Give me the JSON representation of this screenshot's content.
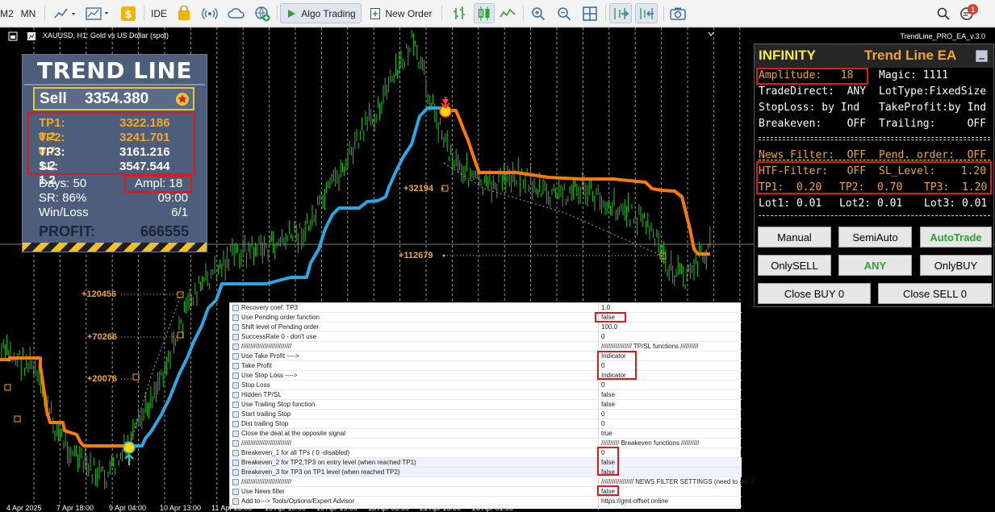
{
  "toolbar": {
    "tf_m2": "M2",
    "tf_mn": "MN",
    "ide": "IDE",
    "algo_trading": "Algo Trading",
    "new_order": "New Order",
    "notification_count": "1"
  },
  "chart": {
    "title": "XAUUSD, H1:  Gold vs US Dollar (spot)",
    "ea_name": "TrendLine_PRO_EA_v.3.0",
    "captions": [
      "+120456",
      "+70266",
      "+20076",
      "+32194",
      "+112679"
    ],
    "time_labels": [
      "4 Apr 2025",
      "7 Apr 18:00",
      "9 Apr 04:00",
      "10 Apr 13:00",
      "11 Apr 23:00",
      "15 Apr 10:00",
      "16 Apr 19:00",
      "18 Apr 05:00",
      "21 Apr 15:00",
      "23 Apr 01:00"
    ],
    "colors": {
      "up_trend": "#28a8e6",
      "down_trend": "#ff7a00",
      "candles": "#22c21b",
      "background": "#000000"
    }
  },
  "trend_panel": {
    "title": "TREND LINE",
    "signal": "Sell",
    "price": "3354.380",
    "tp_rows": [
      {
        "label": "TP1: 0.2",
        "value": "3322.186"
      },
      {
        "label": "TP2: 0.7",
        "value": "3241.701"
      },
      {
        "label": "TP3: 1.2",
        "value": "3161.216"
      },
      {
        "label": "SL: 1.2",
        "value": "3547.544"
      }
    ],
    "days": "Days: 50",
    "ampl": "Ampl: 18",
    "sr_label": "SR:  86%",
    "sr_value": "09:00",
    "winloss_label": "Win/Loss",
    "winloss_value": "6/1",
    "profit_label": "PROFIT:",
    "profit_value": "666555"
  },
  "ea_panel": {
    "title1": "INFINITY",
    "title2": "Trend Line EA",
    "amplitude": "Amplitude:   18",
    "magic": "Magic: 1111",
    "trade_direct": "TradeDirect:  ANY",
    "lot_type": "LotType:FixedSize",
    "stop_loss": "StopLoss: by Ind",
    "take_profit": "TakeProfit:by Ind",
    "breakeven": "Breakeven:    OFF",
    "trailing": "Trailing:     OFF",
    "news_filter": "News Filter:  OFF",
    "pend_order": "Pend. order:  OFF",
    "htf_filter": "HTF-Filter:   OFF",
    "sl_level": "SL_Level:    1.20",
    "tp1": "TP1:  0.20",
    "tp2": "TP2:  0.70",
    "tp3": "TP3:  1.20",
    "lot1": "Lot1: 0.01",
    "lot2": "Lot2: 0.01",
    "lot3": "Lot3: 0.01",
    "btn_manual": "Manual",
    "btn_semiauto": "SemiAuto",
    "btn_autotrade": "AutoTrade",
    "btn_onlysell": "OnlySELL",
    "btn_any": "ANY",
    "btn_onlybuy": "OnlyBUY",
    "btn_close_buy": "Close BUY 0",
    "btn_close_sell": "Close SELL 0"
  },
  "settings": {
    "rows": [
      {
        "key": "Recovery coef. TP3",
        "value": "1.0"
      },
      {
        "key": "Use Pending order function",
        "value": "false"
      },
      {
        "key": "Shift level of Pending order",
        "value": "100.0"
      },
      {
        "key": "SuccessRate 0 - don't use",
        "value": "0"
      },
      {
        "key": "////////////////////////////",
        "value": "///////////////// TP/SL functions //////////"
      },
      {
        "key": "Use Take Profit ---->",
        "value": "Indicator"
      },
      {
        "key": "Take Profit",
        "value": "0"
      },
      {
        "key": "Use Stop Loss ---->",
        "value": "Indicator"
      },
      {
        "key": "Stop Loss",
        "value": "0"
      },
      {
        "key": "Hidden TP/SL",
        "value": "false"
      },
      {
        "key": "Use Trailing Stop function",
        "value": "false"
      },
      {
        "key": "Start trailing Stop",
        "value": "0"
      },
      {
        "key": "Dist trailing Stop",
        "value": "0"
      },
      {
        "key": "Close the deal at the opposite signal",
        "value": "true"
      },
      {
        "key": "////////////////////////////",
        "value": "////////// Breakeven functions //////////"
      },
      {
        "key": "Breakeven_1 for all TPs ( 0 -disabled)",
        "value": "0"
      },
      {
        "key": "Breakeven_2 for TP2,TP3 on entry level (when reached TP1)",
        "value": "false"
      },
      {
        "key": "Breakeven_3 for TP3 on TP1 level (when reached TP2)",
        "value": "false"
      },
      {
        "key": "////////////////////////////",
        "value": "////////////////// NEWS FILTER SETTINGS (need to set w"
      },
      {
        "key": "Use News filter",
        "value": "false"
      },
      {
        "key": "Add to---> Tools/Options/Expert Advisor",
        "value": "https://gmt-offset.online"
      }
    ]
  }
}
